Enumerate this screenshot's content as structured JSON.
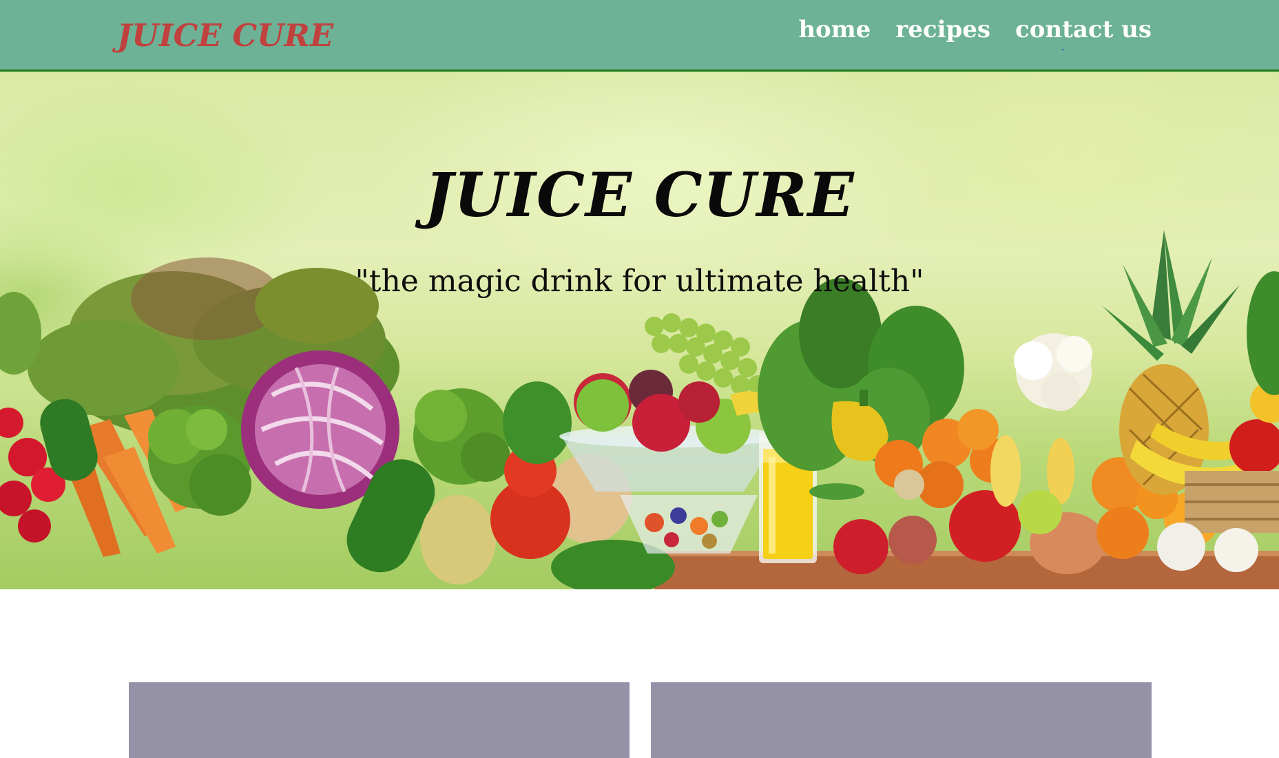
{
  "navbar": {
    "brand": "JUICE CURE",
    "links": [
      {
        "label": "home"
      },
      {
        "label": "recipes"
      },
      {
        "label": "contact us"
      }
    ],
    "background_color": "#6db296",
    "brand_color": "#c0413d"
  },
  "hero": {
    "title": "JUICE CURE",
    "tagline": "\"the magic drink for ultimate health\"",
    "image": "fresh fruits and vegetables with a glass of orange juice"
  },
  "cards": {
    "color": "#9592a8"
  }
}
